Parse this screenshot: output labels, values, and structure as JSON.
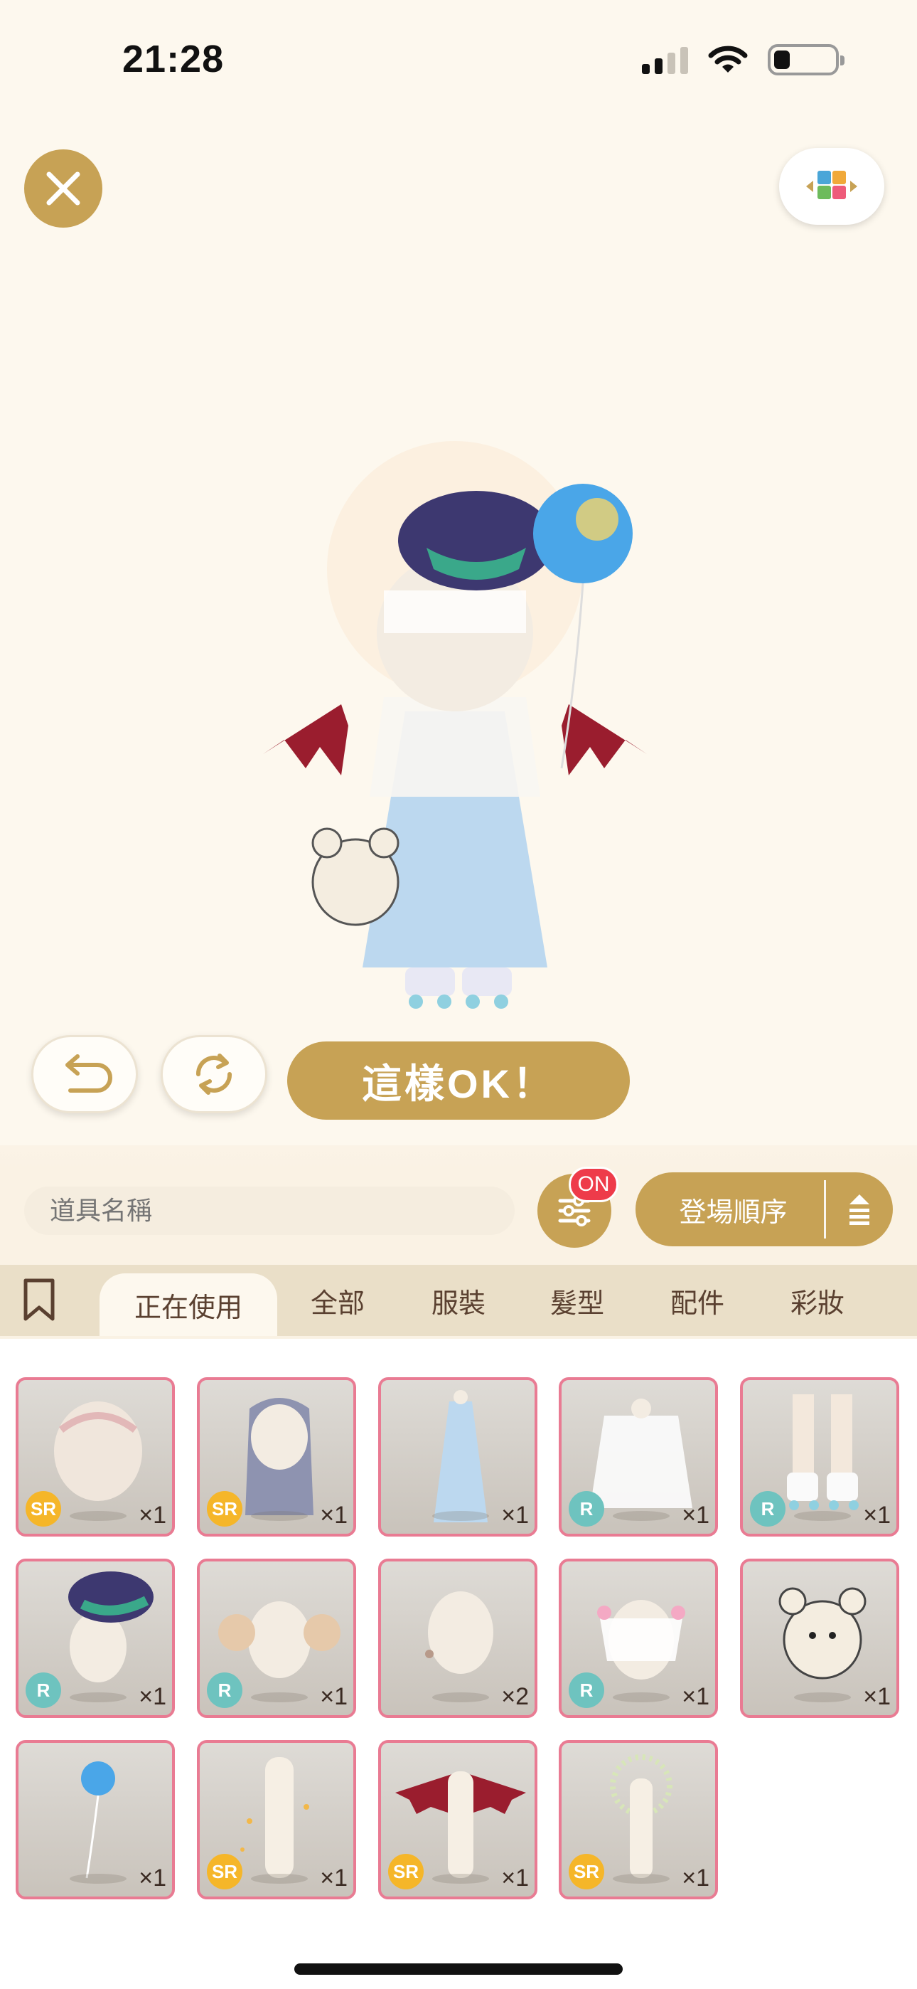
{
  "status": {
    "time": "21:28"
  },
  "toolbar": {
    "ok_label": "這樣OK！"
  },
  "search": {
    "placeholder": "道具名稱"
  },
  "filter": {
    "badge": "ON"
  },
  "sort": {
    "label": "登場順序"
  },
  "tabs": [
    "正在使用",
    "全部",
    "服裝",
    "髮型",
    "配件",
    "彩妝"
  ],
  "active_tab": "正在使用",
  "items": [
    {
      "rarity": "SR",
      "qty": "×1",
      "icon": "hair-wig-icon"
    },
    {
      "rarity": "SR",
      "qty": "×1",
      "icon": "long-hair-icon"
    },
    {
      "rarity": "",
      "qty": "×1",
      "icon": "blue-dress-icon"
    },
    {
      "rarity": "R",
      "qty": "×1",
      "icon": "white-cape-icon"
    },
    {
      "rarity": "R",
      "qty": "×1",
      "icon": "roller-skates-icon"
    },
    {
      "rarity": "R",
      "qty": "×1",
      "icon": "fish-hat-icon"
    },
    {
      "rarity": "R",
      "qty": "×1",
      "icon": "bun-hair-icon"
    },
    {
      "rarity": "",
      "qty": "×2",
      "icon": "hair-clip-icon"
    },
    {
      "rarity": "R",
      "qty": "×1",
      "icon": "veil-icon"
    },
    {
      "rarity": "",
      "qty": "×1",
      "icon": "teddy-bear-icon"
    },
    {
      "rarity": "",
      "qty": "×1",
      "icon": "balloon-icon"
    },
    {
      "rarity": "SR",
      "qty": "×1",
      "icon": "sparkle-effect-icon"
    },
    {
      "rarity": "SR",
      "qty": "×1",
      "icon": "bat-wings-icon"
    },
    {
      "rarity": "SR",
      "qty": "×1",
      "icon": "halo-effect-icon"
    }
  ],
  "colors": {
    "accent": "#c7a255",
    "item_border": "#e97b93",
    "badge_red": "#ee3b4a",
    "sr": "#f5b629",
    "r": "#6ec3bf"
  }
}
